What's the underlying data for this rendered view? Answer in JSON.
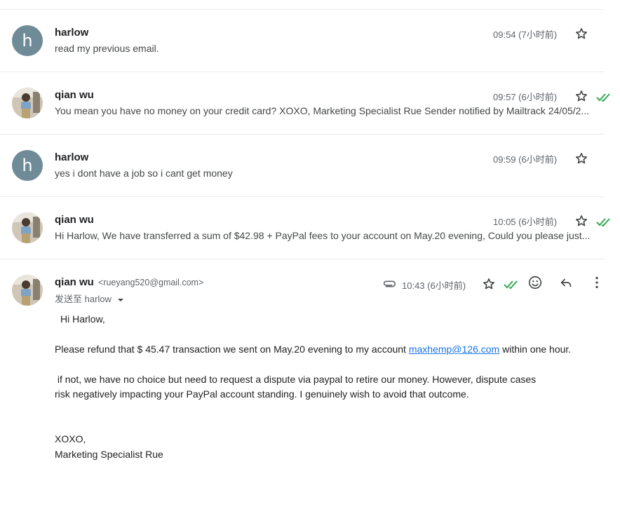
{
  "threads": [
    {
      "sender": "harlow",
      "snippet": "read my previous email.",
      "time": "09:54 (7小时前)",
      "avatar": "letter",
      "letter": "h",
      "checks": false
    },
    {
      "sender": "qian wu",
      "snippet": "You mean you have no money on your credit card? XOXO, Marketing Specialist Rue Sender notified by Mailtrack 24/05/2...",
      "time": "09:57 (6小时前)",
      "avatar": "photo",
      "checks": true
    },
    {
      "sender": "harlow",
      "snippet": "yes i dont have a job so i cant get money",
      "time": "09:59 (6小时前)",
      "avatar": "letter",
      "letter": "h",
      "checks": false
    },
    {
      "sender": "qian wu",
      "snippet": "Hi Harlow, We have transferred a sum of $42.98 + PayPal fees to your account on May.20 evening, Could you please just...",
      "time": "10:05 (6小时前)",
      "avatar": "photo",
      "checks": true
    }
  ],
  "open_email": {
    "from_name": "qian wu",
    "from_email": "<rueyang520@gmail.com>",
    "to_line": "发送至 harlow",
    "time": "10:43 (6小时前)",
    "greeting": "Hi Harlow,",
    "p1_before": "Please refund that $ 45.47 transaction we sent on May.20 evening to my account ",
    "p1_link": "maxhemp@126.com",
    "p1_after": " within one hour.",
    "p2_line1": " if not, we have no choice but need to request a dispute via paypal to retire our money. However, dispute cases",
    "p2_line2": "risk negatively impacting your PayPal account standing. I genuinely wish to avoid that outcome.",
    "sign1": "XOXO,",
    "sign2": "Marketing Specialist Rue"
  },
  "colors": {
    "check": "#34a853",
    "avatar_letter_bg": "#6f8b97",
    "link": "#1a73e8"
  }
}
